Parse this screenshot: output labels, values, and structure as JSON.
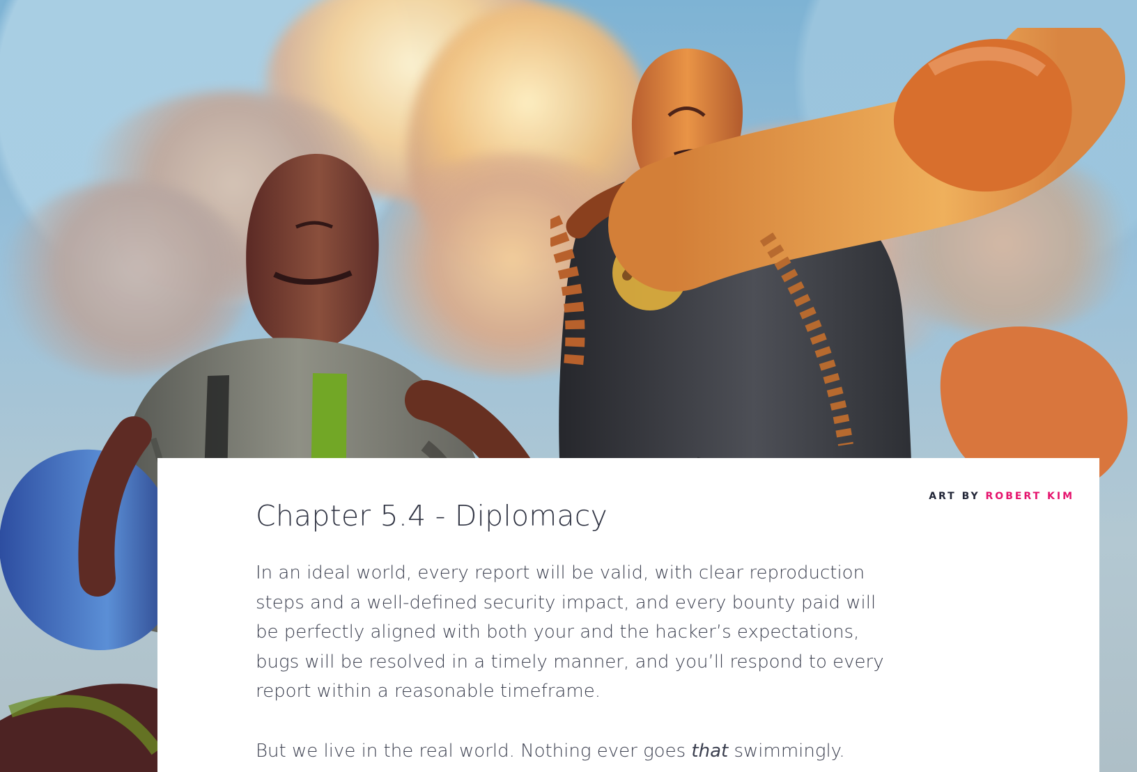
{
  "hero": {
    "artwork_subject": "two stylized fighters against a cloudy sky",
    "colors": {
      "sky": "#7eb3d4",
      "cloud_warm": "#f7d39a",
      "left_fighter_shirt": "#7f8079",
      "suspender": "#7aaa24",
      "glove_blue": "#3f70bd",
      "right_fighter_skin": "#d67d39",
      "right_fighter_outfit": "#3a3e47"
    }
  },
  "card": {
    "credit": {
      "prefix": "ART BY",
      "artist": "ROBERT KIM"
    },
    "title": "Chapter 5.4 - Diplomacy",
    "paragraphs": [
      {
        "text": "In an ideal world, every report will be valid, with clear reproduction steps and a well-defined security impact, and every bounty paid will be perfectly aligned with both your and the hacker’s expectations, bugs will be resolved in a timely manner, and you’ll respond to every report within a reasonable timeframe."
      },
      {
        "before": "But we live in the real world. Nothing ever goes ",
        "emphasis": "that",
        "after": " swimmingly."
      }
    ]
  },
  "theme": {
    "accent": "#e5136d",
    "heading": "#2f3342",
    "body": "#3a3e4e",
    "card_background": "#ffffff"
  }
}
